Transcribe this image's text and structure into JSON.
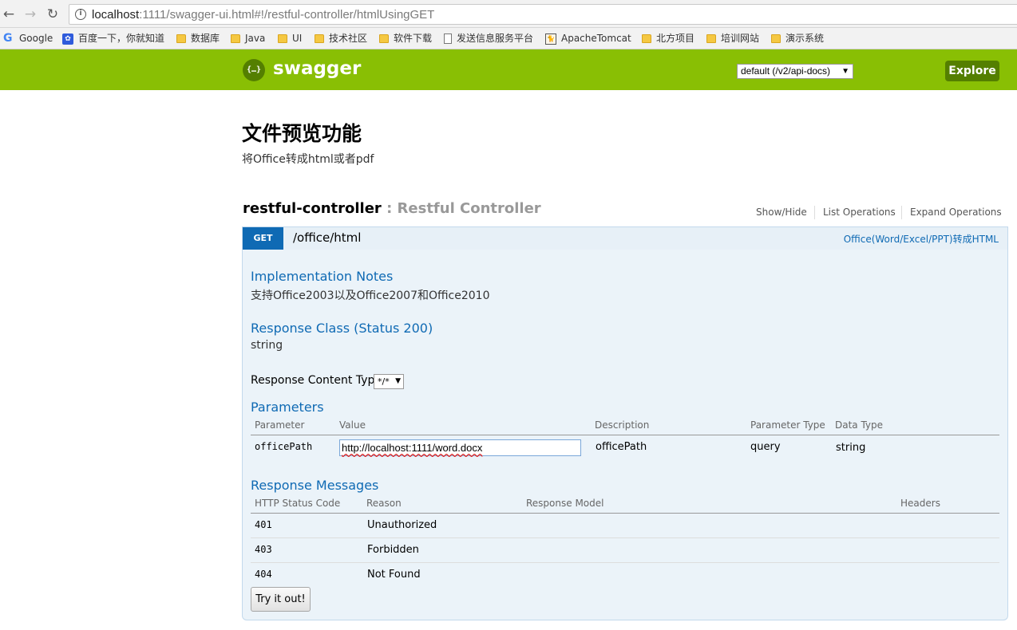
{
  "browser": {
    "back_icon": "arrow-left-icon",
    "forward_icon": "arrow-right-icon",
    "reload_icon": "reload-icon",
    "url_host": "localhost",
    "url_rest": ":1111/swagger-ui.html#!/restful-controller/htmlUsingGET",
    "bookmarks": [
      "Google",
      "百度一下，你就知道",
      "数据库",
      "Java",
      "UI",
      "技术社区",
      "软件下载",
      "发送信息服务平台",
      "ApacheTomcat",
      "北方项目",
      "培训网站",
      "演示系统"
    ]
  },
  "header": {
    "logo_glyph": "{…}",
    "title": "swagger",
    "spec_select": "default (/v2/api-docs)",
    "explore_label": "Explore",
    "brand_color": "#89bf04"
  },
  "info": {
    "title": "文件预览功能",
    "description": "将Office转成html或者pdf"
  },
  "resource": {
    "name": "restful-controller",
    "separator": " : ",
    "description": "Restful Controller",
    "links": [
      "Show/Hide",
      "List Operations",
      "Expand Operations"
    ]
  },
  "operation": {
    "method": "GET",
    "path": "/office/html",
    "summary": "Office(Word/Excel/PPT)转成HTML",
    "notes_heading": "Implementation Notes",
    "notes": "支持Office2003以及Office2007和Office2010",
    "response_class_heading": "Response Class (Status 200)",
    "response_class": "string",
    "content_type_label": "Response Content Type",
    "content_type_value": "*/*",
    "parameters_heading": "Parameters",
    "parameter_columns": [
      "Parameter",
      "Value",
      "Description",
      "Parameter Type",
      "Data Type"
    ],
    "parameters": [
      {
        "name": "officePath",
        "value": "http://localhost:1111/word.docx",
        "description": "officePath",
        "param_type": "query",
        "data_type": "string"
      }
    ],
    "messages_heading": "Response Messages",
    "message_columns": [
      "HTTP Status Code",
      "Reason",
      "Response Model",
      "Headers"
    ],
    "messages": [
      {
        "code": "401",
        "reason": "Unauthorized"
      },
      {
        "code": "403",
        "reason": "Forbidden"
      },
      {
        "code": "404",
        "reason": "Not Found"
      }
    ],
    "try_label": "Try it out!"
  }
}
